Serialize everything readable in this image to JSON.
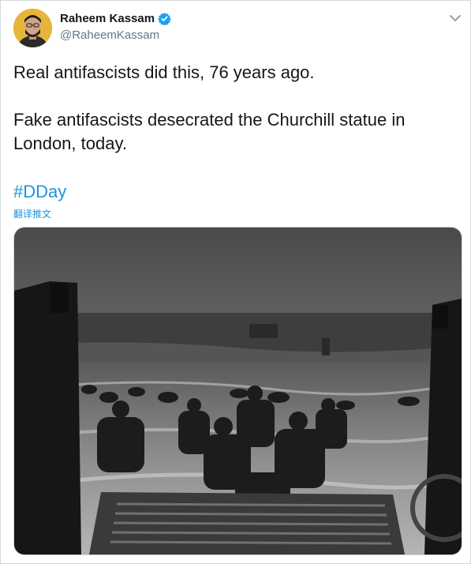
{
  "user": {
    "display_name": "Raheem Kassam",
    "handle": "@RaheemKassam",
    "verified": true
  },
  "tweet": {
    "line1": "Real antifascists did this, 76 years ago.",
    "line2": "Fake antifascists desecrated the Churchill statue in",
    "line3": "London, today.",
    "hashtag": "#DDay",
    "translate_label": "翻译推文"
  },
  "icons": {
    "verified": "verified-badge-icon",
    "menu": "chevron-down-icon"
  },
  "colors": {
    "link": "#1b95e0",
    "text": "#14171a",
    "secondary": "#657786",
    "verified": "#1da1f2"
  },
  "media": {
    "type": "photo",
    "style": "black-and-white"
  }
}
